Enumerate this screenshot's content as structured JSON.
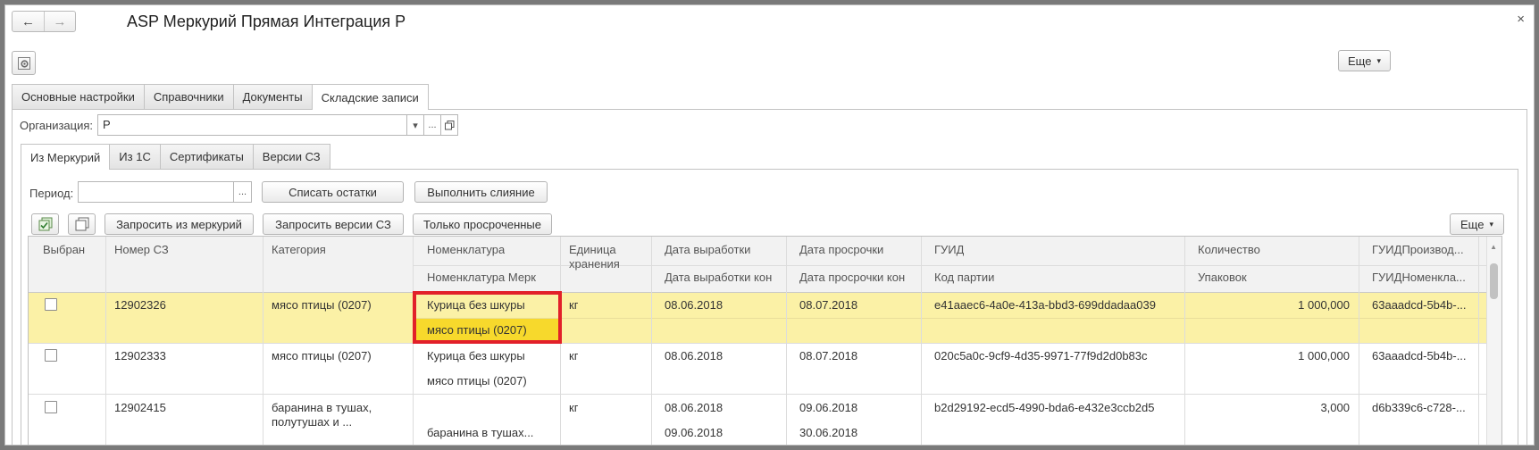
{
  "window": {
    "title": "ASP Меркурий Прямая Интеграция Р",
    "back_icon": "←",
    "forward_icon": "→",
    "close_icon": "×",
    "more_label": "Еще"
  },
  "main_tabs": [
    {
      "label": "Основные настройки"
    },
    {
      "label": "Справочники"
    },
    {
      "label": "Документы"
    },
    {
      "label": "Складские записи"
    }
  ],
  "organization": {
    "label": "Организация:",
    "value": "Р"
  },
  "sub_tabs": [
    {
      "label": "Из Меркурий"
    },
    {
      "label": "Из 1С"
    },
    {
      "label": "Сертификаты"
    },
    {
      "label": "Версии СЗ"
    }
  ],
  "period": {
    "label": "Период:",
    "value": "",
    "ellipsis": "..."
  },
  "actions": {
    "write_off": "Списать остатки",
    "merge": "Выполнить слияние",
    "request_mercury": "Запросить из меркурий",
    "request_versions": "Запросить версии СЗ",
    "only_expired": "Только просроченные",
    "more": "Еще"
  },
  "grid": {
    "headers": {
      "selected": "Выбран",
      "sz_number": "Номер СЗ",
      "category": "Категория",
      "nomenclature": "Номенклатура",
      "nomenclature_merc": "Номенклатура Мерк",
      "unit": "Единица хранения",
      "prod_date": "Дата выработки",
      "prod_date_end": "Дата выработки кон",
      "exp_date": "Дата просрочки",
      "exp_date_end": "Дата просрочки кон",
      "guid": "ГУИД",
      "batch_code": "Код партии",
      "quantity": "Количество",
      "packages": "Упаковок",
      "guid_producer": "ГУИДПроизвод...",
      "guid_nomenclature": "ГУИДНоменкла..."
    },
    "rows": [
      {
        "sz_number": "12902326",
        "category": "мясо птицы (0207)",
        "nomenclature": "Курица без шкуры",
        "nomenclature_merc": "мясо птицы (0207)",
        "unit": "кг",
        "prod_date": "08.06.2018",
        "prod_date_end": "",
        "exp_date": "08.07.2018",
        "exp_date_end": "",
        "guid": "e41aaec6-4a0e-413a-bbd3-699ddadaa039",
        "quantity": "1 000,000",
        "guid_producer": "63aaadcd-5b4b-..."
      },
      {
        "sz_number": "12902333",
        "category": "мясо птицы (0207)",
        "nomenclature": "Курица без шкуры",
        "nomenclature_merc": "мясо птицы (0207)",
        "unit": "кг",
        "prod_date": "08.06.2018",
        "prod_date_end": "",
        "exp_date": "08.07.2018",
        "exp_date_end": "",
        "guid": "020c5a0c-9cf9-4d35-9971-77f9d2d0b83c",
        "quantity": "1 000,000",
        "guid_producer": "63aaadcd-5b4b-..."
      },
      {
        "sz_number": "12902415",
        "category_line1": "баранина в тушах,",
        "category_line2": "полутушах и ...",
        "nomenclature": "",
        "nomenclature_merc": "баранина в тушах...",
        "unit": "кг",
        "prod_date": "08.06.2018",
        "prod_date_end": "09.06.2018",
        "exp_date": "09.06.2018",
        "exp_date_end": "30.06.2018",
        "guid": "b2d29192-ecd5-4990-bda6-e432e3ccb2d5",
        "quantity": "3,000",
        "guid_producer": "d6b339c6-c728-..."
      }
    ]
  },
  "colors": {
    "selected_row": "#fbf1a6",
    "selected_cell": "#f7d92c",
    "highlight_border": "#e2202a"
  }
}
